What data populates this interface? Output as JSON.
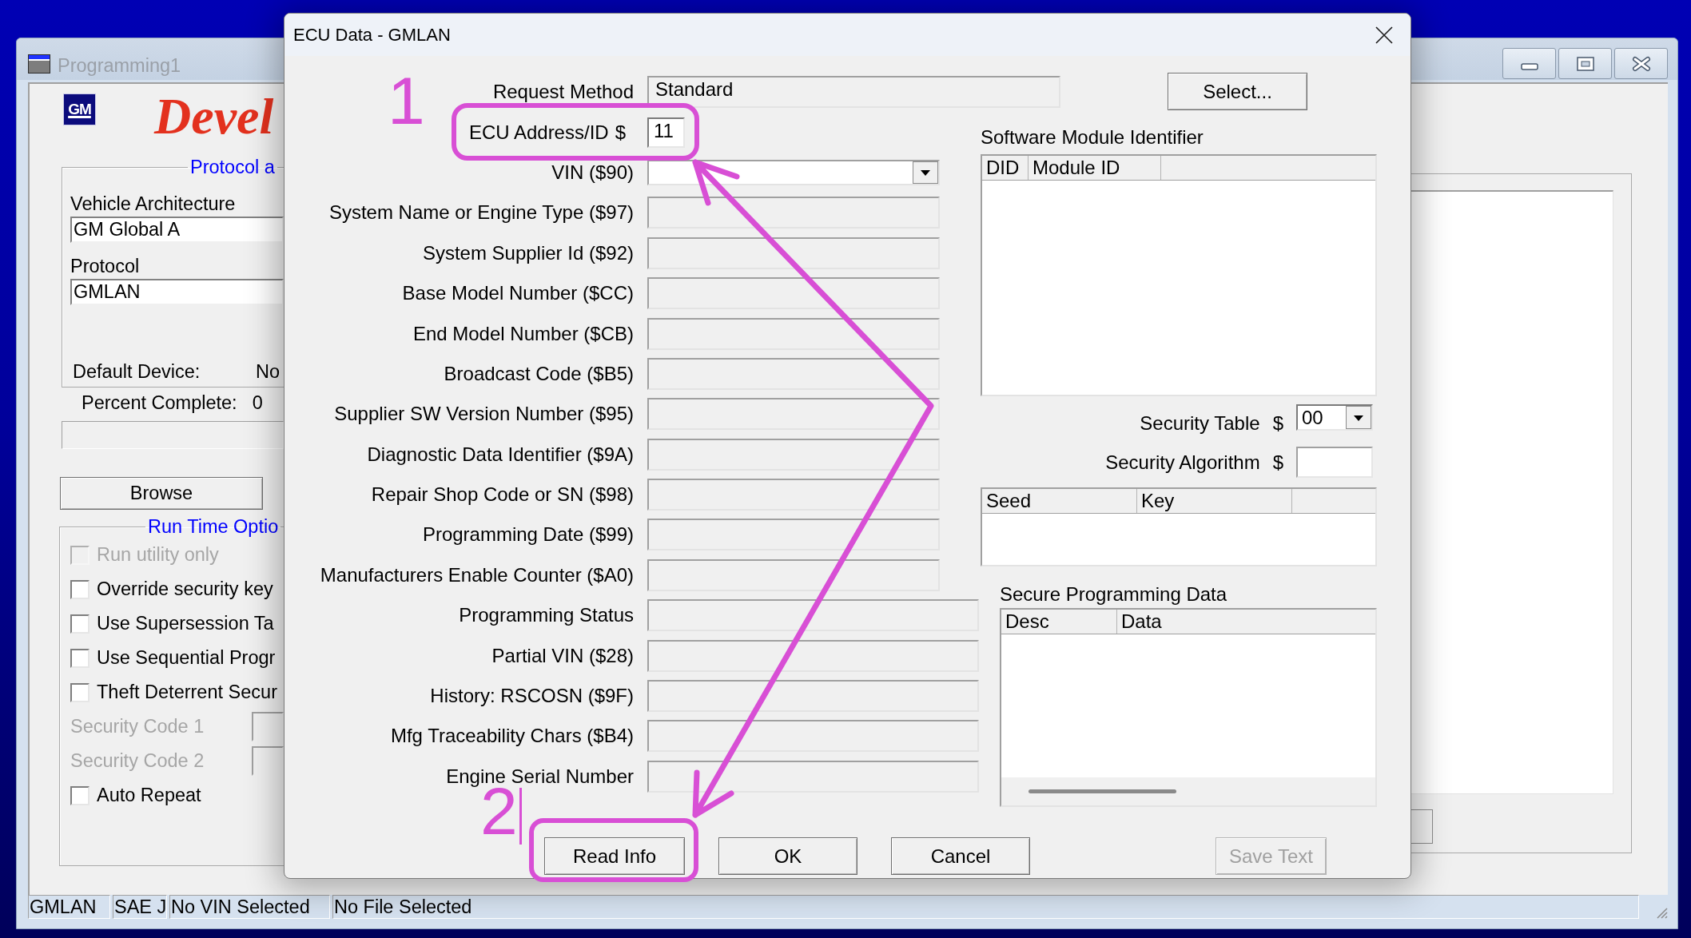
{
  "main_window": {
    "title": "Programming1",
    "logo_text": "GM",
    "banner_text": "Devel",
    "protocol_group": {
      "legend": "Protocol a",
      "vehicle_architecture": {
        "label": "Vehicle Architecture",
        "value": "GM Global A"
      },
      "protocol": {
        "label": "Protocol",
        "value": "GMLAN"
      },
      "default_device": {
        "label": "Default Device:",
        "value": "No"
      }
    },
    "percent_complete": {
      "label": "Percent Complete:",
      "value": "0"
    },
    "progress": {
      "level": 0
    },
    "browse_button": "Browse",
    "run_time_options": {
      "legend": "Run Time Optio",
      "items": [
        {
          "kind": "checkbox",
          "label": "Run utility only",
          "checked": false,
          "disabled": true
        },
        {
          "kind": "checkbox",
          "label": "Override security key",
          "checked": false,
          "disabled": false
        },
        {
          "kind": "checkbox",
          "label": "Use Supersession Ta",
          "checked": false,
          "disabled": false
        },
        {
          "kind": "checkbox",
          "label": "Use Sequential Progr",
          "checked": false,
          "disabled": false
        },
        {
          "kind": "checkbox",
          "label": "Theft Deterrent Secur",
          "checked": false,
          "disabled": false
        },
        {
          "kind": "field",
          "label": "Security Code 1",
          "disabled": true
        },
        {
          "kind": "field",
          "label": "Security Code 2",
          "disabled": true
        },
        {
          "kind": "checkbox",
          "label": "Auto Repeat",
          "checked": false,
          "disabled": false
        }
      ]
    },
    "status_bar": [
      "GMLAN",
      "SAE J",
      "No VIN Selected",
      "No File Selected"
    ]
  },
  "dialog": {
    "title": "ECU Data - GMLAN",
    "fields": [
      {
        "kind": "long",
        "label": "Request Method",
        "value": "Standard"
      },
      {
        "kind": "short",
        "label": "ECU Address/ID",
        "prefix": "$",
        "value": "11"
      },
      {
        "kind": "dropdown",
        "label": "VIN ($90)"
      },
      {
        "kind": "box",
        "label": "System Name or Engine Type ($97)"
      },
      {
        "kind": "box",
        "label": "System Supplier Id ($92)"
      },
      {
        "kind": "box",
        "label": "Base Model Number ($CC)"
      },
      {
        "kind": "box",
        "label": "End Model Number ($CB)"
      },
      {
        "kind": "box",
        "label": "Broadcast Code ($B5)"
      },
      {
        "kind": "box",
        "label": "Supplier SW Version Number ($95)"
      },
      {
        "kind": "box",
        "label": "Diagnostic Data Identifier ($9A)"
      },
      {
        "kind": "box",
        "label": "Repair Shop Code or SN ($98)"
      },
      {
        "kind": "box",
        "label": "Programming Date ($99)"
      },
      {
        "kind": "box",
        "label": "Manufacturers Enable Counter ($A0)"
      },
      {
        "kind": "wide_box",
        "label": "Programming Status"
      },
      {
        "kind": "wide_box",
        "label": "Partial VIN ($28)"
      },
      {
        "kind": "wide_box",
        "label": "History: RSCOSN ($9F)"
      },
      {
        "kind": "wide_box",
        "label": "Mfg Traceability Chars ($B4)"
      },
      {
        "kind": "wide_box",
        "label": "Engine Serial Number"
      }
    ],
    "select_button": "Select...",
    "software_module_identifier": {
      "title": "Software Module Identifier",
      "columns": [
        "DID",
        "Module ID"
      ]
    },
    "security_table": {
      "label": "Security Table",
      "prefix": "$",
      "value": "00"
    },
    "security_algorithm": {
      "label": "Security Algorithm",
      "prefix": "$"
    },
    "seed_key_table": {
      "columns": [
        "Seed",
        "Key"
      ]
    },
    "secure_programming_data": {
      "title": "Secure Programming Data",
      "columns": [
        "Desc",
        "Data"
      ]
    },
    "buttons": [
      {
        "label": "Read Info",
        "disabled": false
      },
      {
        "label": "OK",
        "disabled": false
      },
      {
        "label": "Cancel",
        "disabled": false
      },
      {
        "label": "Save Text",
        "disabled": true
      }
    ]
  },
  "annotations": {
    "step_1": "1",
    "step_2": "2"
  }
}
